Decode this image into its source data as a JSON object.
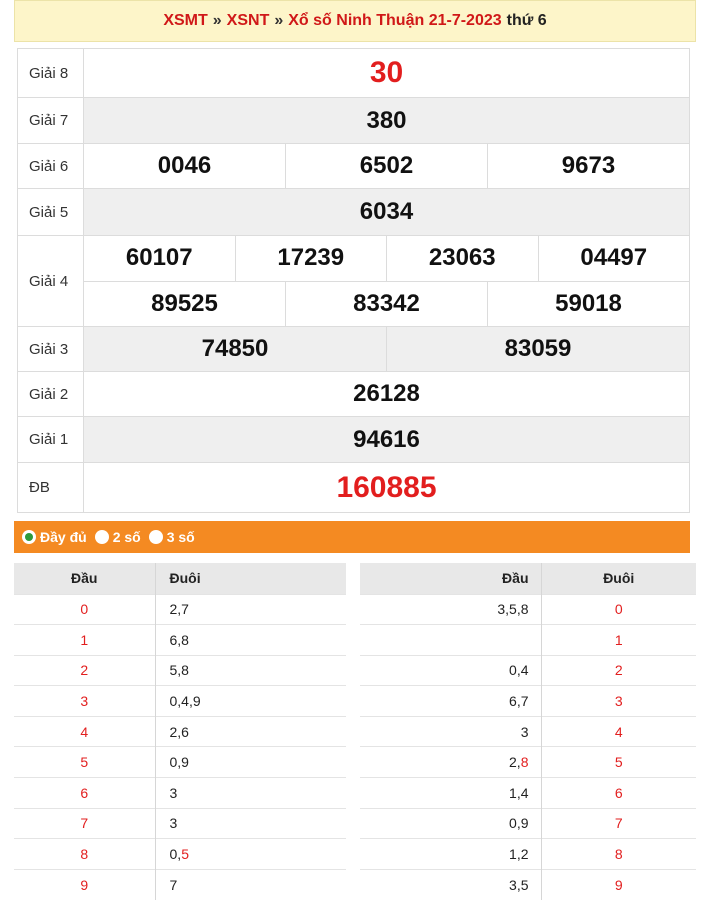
{
  "header": {
    "crumb1": "XSMT",
    "crumb2": "XSNT",
    "crumb3": "Xổ số Ninh Thuận 21-7-2023",
    "separator": "»",
    "weekday": "thứ 6"
  },
  "results": [
    {
      "label": "Giải 8",
      "rows": [
        [
          "30"
        ]
      ],
      "red": true,
      "big": true
    },
    {
      "label": "Giải 7",
      "rows": [
        [
          "380"
        ]
      ]
    },
    {
      "label": "Giải 6",
      "rows": [
        [
          "0046",
          "6502",
          "9673"
        ]
      ]
    },
    {
      "label": "Giải 5",
      "rows": [
        [
          "6034"
        ]
      ]
    },
    {
      "label": "Giải 4",
      "rows": [
        [
          "60107",
          "17239",
          "23063",
          "04497"
        ],
        [
          "89525",
          "83342",
          "59018"
        ]
      ]
    },
    {
      "label": "Giải 3",
      "rows": [
        [
          "74850",
          "83059"
        ]
      ]
    },
    {
      "label": "Giải 2",
      "rows": [
        [
          "26128"
        ]
      ]
    },
    {
      "label": "Giải 1",
      "rows": [
        [
          "94616"
        ]
      ]
    },
    {
      "label": "ĐB",
      "rows": [
        [
          "160885"
        ]
      ],
      "red": true,
      "big": true
    }
  ],
  "options": [
    {
      "label": "Đầy đủ",
      "checked": true
    },
    {
      "label": "2 số",
      "checked": false
    },
    {
      "label": "3 số",
      "checked": false
    }
  ],
  "dau_table": {
    "headers": [
      "Đầu",
      "Đuôi"
    ],
    "rows": [
      {
        "dau": "0",
        "duoi": [
          {
            "t": "2,7"
          }
        ]
      },
      {
        "dau": "1",
        "duoi": [
          {
            "t": "6,8"
          }
        ]
      },
      {
        "dau": "2",
        "duoi": [
          {
            "t": "5,8"
          }
        ]
      },
      {
        "dau": "3",
        "duoi": [
          {
            "t": "0,4,9"
          }
        ]
      },
      {
        "dau": "4",
        "duoi": [
          {
            "t": "2,6"
          }
        ]
      },
      {
        "dau": "5",
        "duoi": [
          {
            "t": "0,9"
          }
        ]
      },
      {
        "dau": "6",
        "duoi": [
          {
            "t": "3"
          }
        ]
      },
      {
        "dau": "7",
        "duoi": [
          {
            "t": "3"
          }
        ]
      },
      {
        "dau": "8",
        "duoi": [
          {
            "t": "0,"
          },
          {
            "t": "5",
            "red": true
          }
        ]
      },
      {
        "dau": "9",
        "duoi": [
          {
            "t": "7"
          }
        ]
      }
    ]
  },
  "duoi_table": {
    "headers": [
      "Đầu",
      "Đuôi"
    ],
    "rows": [
      {
        "dau": [
          {
            "t": "3,5,8"
          }
        ],
        "duoi": "0"
      },
      {
        "dau": [],
        "duoi": "1"
      },
      {
        "dau": [
          {
            "t": "0,4"
          }
        ],
        "duoi": "2"
      },
      {
        "dau": [
          {
            "t": "6,7"
          }
        ],
        "duoi": "3"
      },
      {
        "dau": [
          {
            "t": "3"
          }
        ],
        "duoi": "4"
      },
      {
        "dau": [
          {
            "t": "2,"
          },
          {
            "t": "8",
            "red": true
          }
        ],
        "duoi": "5"
      },
      {
        "dau": [
          {
            "t": "1,4"
          }
        ],
        "duoi": "6"
      },
      {
        "dau": [
          {
            "t": "0,9"
          }
        ],
        "duoi": "7"
      },
      {
        "dau": [
          {
            "t": "1,2"
          }
        ],
        "duoi": "8"
      },
      {
        "dau": [
          {
            "t": "3,5"
          }
        ],
        "duoi": "9"
      }
    ]
  },
  "colors": {
    "accent_red": "#e21e1e",
    "header_bg": "#fdf5c9",
    "options_bg": "#f48a22",
    "radio_checked": "#2e9a3a"
  }
}
